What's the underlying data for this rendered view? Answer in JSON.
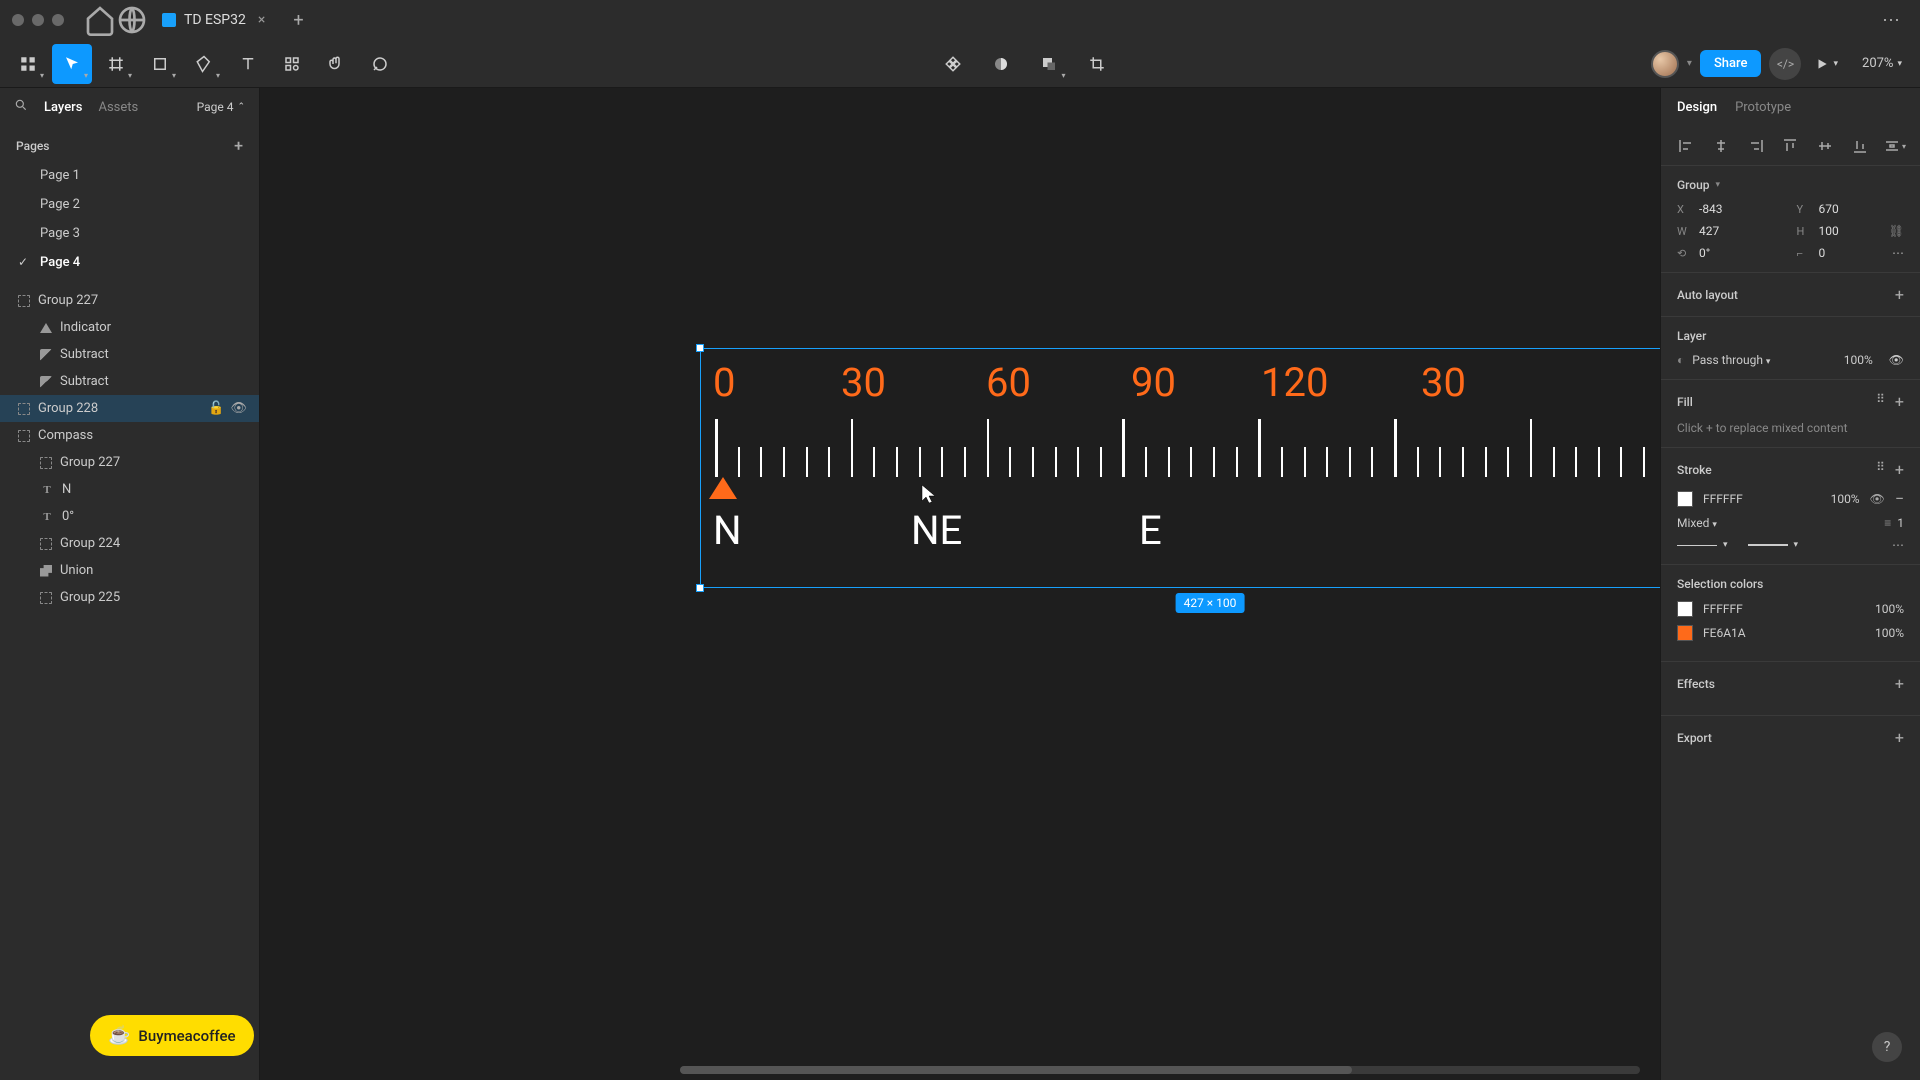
{
  "titlebar": {
    "tab_name": "TD ESP32"
  },
  "toolbar": {
    "share": "Share",
    "zoom": "207%"
  },
  "left": {
    "tab_layers": "Layers",
    "tab_assets": "Assets",
    "page_selector": "Page 4",
    "pages_header": "Pages",
    "pages": [
      "Page 1",
      "Page 2",
      "Page 3",
      "Page 4"
    ],
    "layers": {
      "g227": "Group 227",
      "indicator": "Indicator",
      "sub1": "Subtract",
      "sub2": "Subtract",
      "g228": "Group 228",
      "compass": "Compass",
      "g227b": "Group 227",
      "n": "N",
      "zero": "0°",
      "g224": "Group 224",
      "union": "Union",
      "g225": "Group 225"
    },
    "bmac": "Buymeacoffee"
  },
  "canvas": {
    "nums": [
      "0",
      "30",
      "60",
      "90",
      "120",
      "30"
    ],
    "dirs": {
      "n": "N",
      "ne": "NE",
      "e": "E"
    },
    "dim": "427 × 100"
  },
  "right": {
    "tab_design": "Design",
    "tab_proto": "Prototype",
    "group_label": "Group",
    "props": {
      "x": "-843",
      "y": "670",
      "w": "427",
      "h": "100",
      "rot": "0°",
      "rad": "0"
    },
    "x_lbl": "X",
    "y_lbl": "Y",
    "w_lbl": "W",
    "h_lbl": "H",
    "autolayout": "Auto layout",
    "layer_section": "Layer",
    "blend": "Pass through",
    "blend_pct": "100%",
    "fill_section": "Fill",
    "fill_hint": "Click + to replace mixed content",
    "stroke_section": "Stroke",
    "stroke_hex": "FFFFFF",
    "stroke_pct": "100%",
    "stroke_mixed": "Mixed",
    "stroke_weight": "1",
    "selcolors": "Selection colors",
    "sc1_hex": "FFFFFF",
    "sc1_pct": "100%",
    "sc2_hex": "FE6A1A",
    "sc2_pct": "100%",
    "effects": "Effects",
    "export": "Export"
  }
}
